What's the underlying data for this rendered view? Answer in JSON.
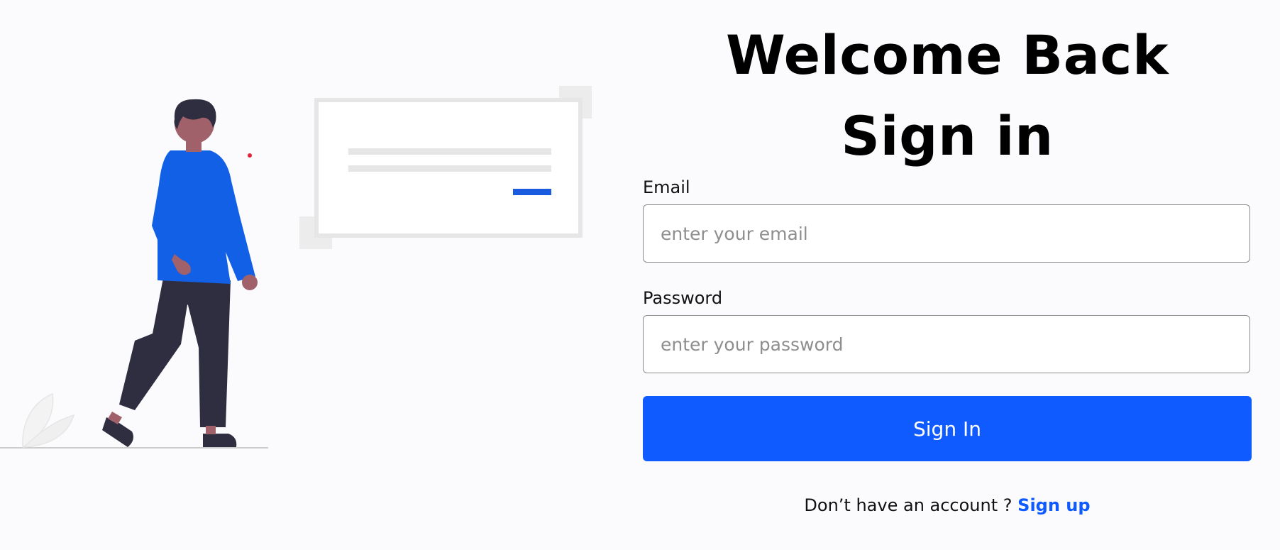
{
  "header": {
    "title": "Welcome Back",
    "subtitle": "Sign in"
  },
  "form": {
    "email": {
      "label": "Email",
      "placeholder": "enter your email"
    },
    "password": {
      "label": "Password",
      "placeholder": "enter your password"
    },
    "submit_label": "Sign In"
  },
  "footer": {
    "prompt": "Don’t have an account ?",
    "link_label": "Sign up"
  },
  "colors": {
    "accent": "#0f5bff",
    "background": "#fbfbfd"
  }
}
